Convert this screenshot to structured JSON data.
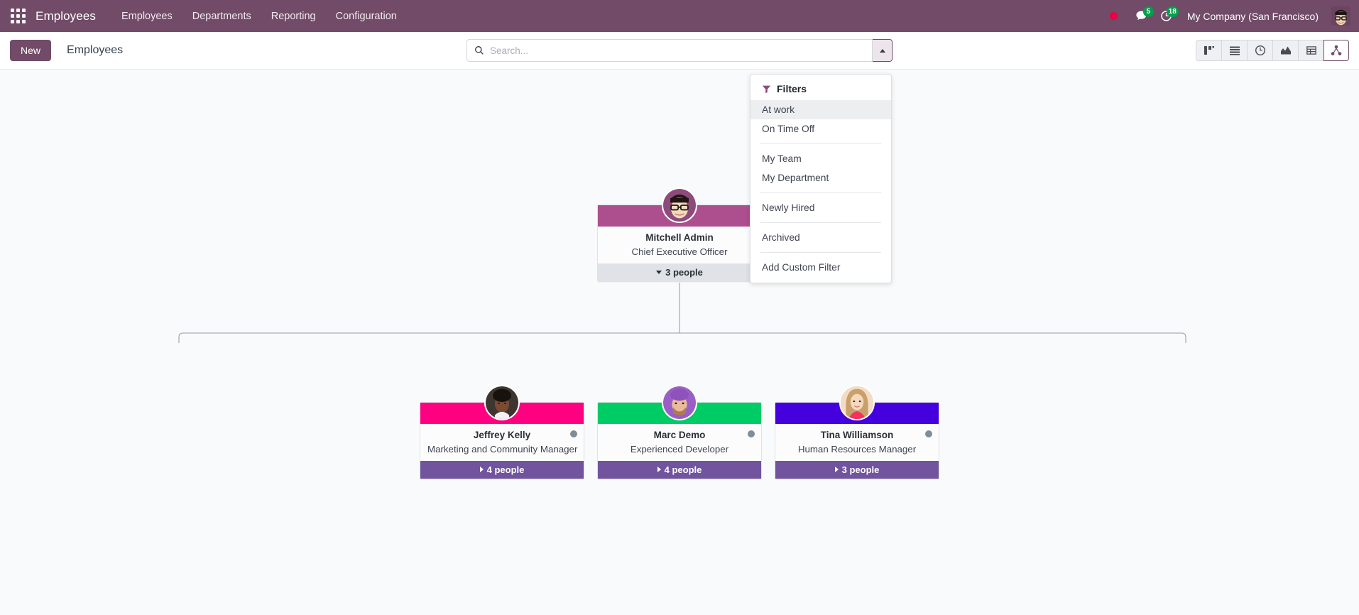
{
  "navbar": {
    "apps_icon": "grid-apps-icon",
    "brand": "Employees",
    "menu_items": [
      {
        "label": "Employees"
      },
      {
        "label": "Departments"
      },
      {
        "label": "Reporting"
      },
      {
        "label": "Configuration"
      }
    ],
    "recording_indicator": "record-dot-icon",
    "messages_icon": "messages-icon",
    "messages_count": "5",
    "activities_icon": "activities-clock-icon",
    "activities_count": "18",
    "company": "My Company (San Francisco)",
    "user_avatar": "user-avatar"
  },
  "control_panel": {
    "new_label": "New",
    "breadcrumb": "Employees",
    "search": {
      "icon": "search-icon",
      "placeholder": "Search...",
      "value": "",
      "toggle_icon": "caret-up-icon"
    },
    "views": [
      {
        "name": "kanban",
        "icon": "kanban-icon",
        "active": false
      },
      {
        "name": "list",
        "icon": "list-icon",
        "active": false
      },
      {
        "name": "activity",
        "icon": "clock-icon",
        "active": false
      },
      {
        "name": "graph",
        "icon": "graph-icon",
        "active": false
      },
      {
        "name": "pivot",
        "icon": "pivot-table-icon",
        "active": false
      },
      {
        "name": "org-chart",
        "icon": "org-chart-icon",
        "active": true
      }
    ]
  },
  "filters_dropdown": {
    "icon": "funnel-icon",
    "title": "Filters",
    "groups": [
      {
        "items": [
          {
            "label": "At work",
            "highlighted": true
          },
          {
            "label": "On Time Off",
            "highlighted": false
          }
        ]
      },
      {
        "items": [
          {
            "label": "My Team",
            "highlighted": false
          },
          {
            "label": "My Department",
            "highlighted": false
          }
        ]
      },
      {
        "items": [
          {
            "label": "Newly Hired",
            "highlighted": false
          }
        ]
      },
      {
        "items": [
          {
            "label": "Archived",
            "highlighted": false
          }
        ]
      },
      {
        "items": [
          {
            "label": "Add Custom Filter",
            "highlighted": false
          }
        ]
      }
    ]
  },
  "org_chart": {
    "root": {
      "name": "Mitchell Admin",
      "job": "Chief Executive Officer",
      "header_color": "#AD4E8E",
      "subordinates_label": "3 people",
      "has_status_dot": false,
      "expanded": true
    },
    "children": [
      {
        "name": "Jeffrey Kelly",
        "job": "Marketing and Community Manager",
        "header_color": "#FF0080",
        "subordinates_label": "4 people",
        "has_status_dot": true,
        "expanded": false
      },
      {
        "name": "Marc Demo",
        "job": "Experienced Developer",
        "header_color": "#00CC66",
        "subordinates_label": "4 people",
        "has_status_dot": true,
        "expanded": false
      },
      {
        "name": "Tina Williamson",
        "job": "Human Resources Manager",
        "header_color": "#4400DD",
        "subordinates_label": "3 people",
        "has_status_dot": true,
        "expanded": false
      }
    ]
  },
  "theme": {
    "brand_purple": "#714B67",
    "footer_purple": "#71539E",
    "page_bg": "#f9fafb",
    "status_dot": "#7f8c99"
  }
}
